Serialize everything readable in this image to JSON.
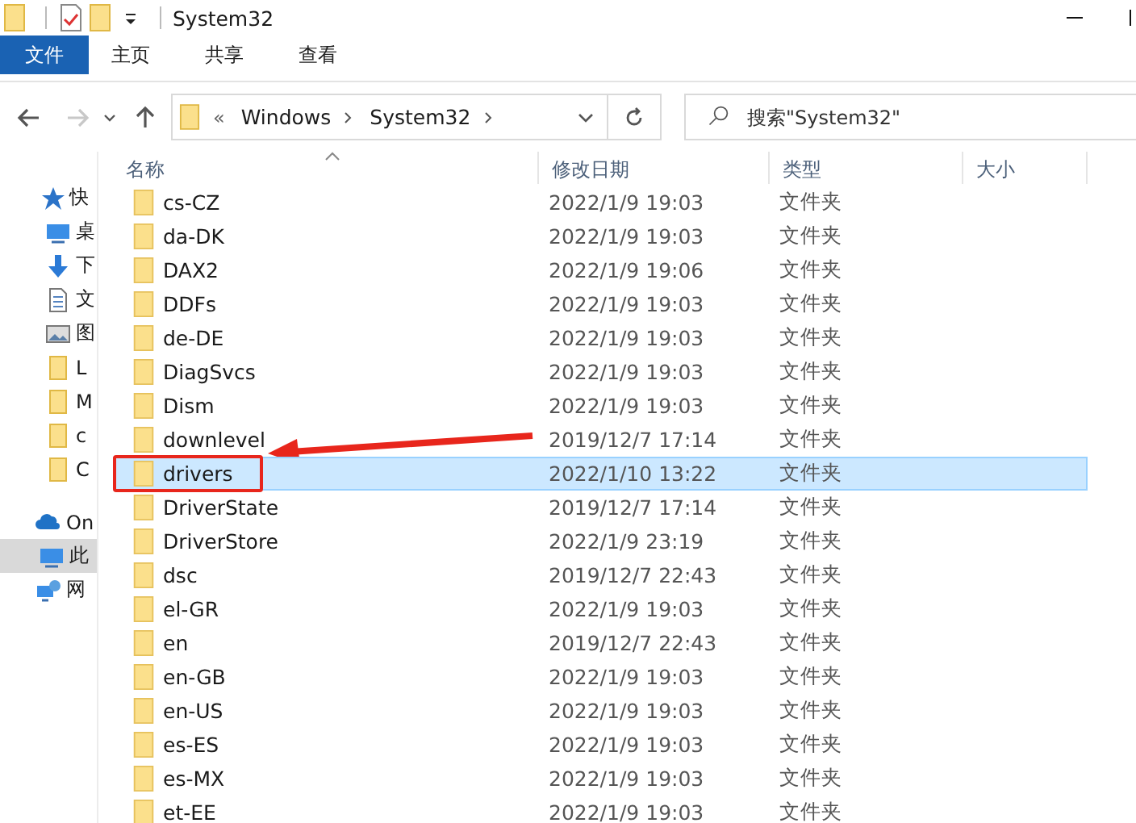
{
  "window": {
    "title": "System32"
  },
  "ribbon_tabs": [
    {
      "label": "文件",
      "selected": true
    },
    {
      "label": "主页",
      "selected": false
    },
    {
      "label": "共享",
      "selected": false
    },
    {
      "label": "查看",
      "selected": false
    }
  ],
  "nav_buttons": [
    {
      "kind": "back",
      "disabled": false
    },
    {
      "kind": "forward",
      "disabled": true
    },
    {
      "kind": "recent",
      "disabled": false
    },
    {
      "kind": "up",
      "disabled": false
    }
  ],
  "address": {
    "overflow": "«",
    "crumbs": [
      "Windows",
      "System32"
    ]
  },
  "search": {
    "placeholder": "搜索\"System32\""
  },
  "sidebar": {
    "items": [
      {
        "label": "快",
        "kind": "star",
        "selected": false
      },
      {
        "label": "桌",
        "kind": "desktop",
        "selected": false
      },
      {
        "label": "下",
        "kind": "download",
        "selected": false
      },
      {
        "label": "文",
        "kind": "document",
        "selected": false
      },
      {
        "label": "图",
        "kind": "image",
        "selected": false
      },
      {
        "label": "L",
        "kind": "folder",
        "selected": false
      },
      {
        "label": "M",
        "kind": "folder",
        "selected": false
      },
      {
        "label": "c",
        "kind": "folder",
        "selected": false
      },
      {
        "label": "C",
        "kind": "folder",
        "selected": false
      },
      {
        "label": "On",
        "kind": "cloud",
        "selected": false
      },
      {
        "label": "此",
        "kind": "pc",
        "selected": true
      },
      {
        "label": "网",
        "kind": "network",
        "selected": false
      }
    ]
  },
  "table": {
    "columns": [
      {
        "label": "名称",
        "sorted": true
      },
      {
        "label": "修改日期",
        "sorted": false
      },
      {
        "label": "类型",
        "sorted": false
      },
      {
        "label": "大小",
        "sorted": false
      }
    ],
    "rows": [
      {
        "name": "cs-CZ",
        "modified": "2022/1/9 19:03",
        "type": "文件夹",
        "selected": false
      },
      {
        "name": "da-DK",
        "modified": "2022/1/9 19:03",
        "type": "文件夹",
        "selected": false
      },
      {
        "name": "DAX2",
        "modified": "2022/1/9 19:06",
        "type": "文件夹",
        "selected": false
      },
      {
        "name": "DDFs",
        "modified": "2022/1/9 19:03",
        "type": "文件夹",
        "selected": false
      },
      {
        "name": "de-DE",
        "modified": "2022/1/9 19:03",
        "type": "文件夹",
        "selected": false
      },
      {
        "name": "DiagSvcs",
        "modified": "2022/1/9 19:03",
        "type": "文件夹",
        "selected": false
      },
      {
        "name": "Dism",
        "modified": "2022/1/9 19:03",
        "type": "文件夹",
        "selected": false
      },
      {
        "name": "downlevel",
        "modified": "2019/12/7 17:14",
        "type": "文件夹",
        "selected": false
      },
      {
        "name": "drivers",
        "modified": "2022/1/10 13:22",
        "type": "文件夹",
        "selected": true
      },
      {
        "name": "DriverState",
        "modified": "2019/12/7 17:14",
        "type": "文件夹",
        "selected": false
      },
      {
        "name": "DriverStore",
        "modified": "2022/1/9 23:19",
        "type": "文件夹",
        "selected": false
      },
      {
        "name": "dsc",
        "modified": "2019/12/7 22:43",
        "type": "文件夹",
        "selected": false
      },
      {
        "name": "el-GR",
        "modified": "2022/1/9 19:03",
        "type": "文件夹",
        "selected": false
      },
      {
        "name": "en",
        "modified": "2019/12/7 22:43",
        "type": "文件夹",
        "selected": false
      },
      {
        "name": "en-GB",
        "modified": "2022/1/9 19:03",
        "type": "文件夹",
        "selected": false
      },
      {
        "name": "en-US",
        "modified": "2022/1/9 19:03",
        "type": "文件夹",
        "selected": false
      },
      {
        "name": "es-ES",
        "modified": "2022/1/9 19:03",
        "type": "文件夹",
        "selected": false
      },
      {
        "name": "es-MX",
        "modified": "2022/1/9 19:03",
        "type": "文件夹",
        "selected": false
      },
      {
        "name": "et-EE",
        "modified": "2022/1/9 19:03",
        "type": "文件夹",
        "selected": false
      }
    ]
  }
}
